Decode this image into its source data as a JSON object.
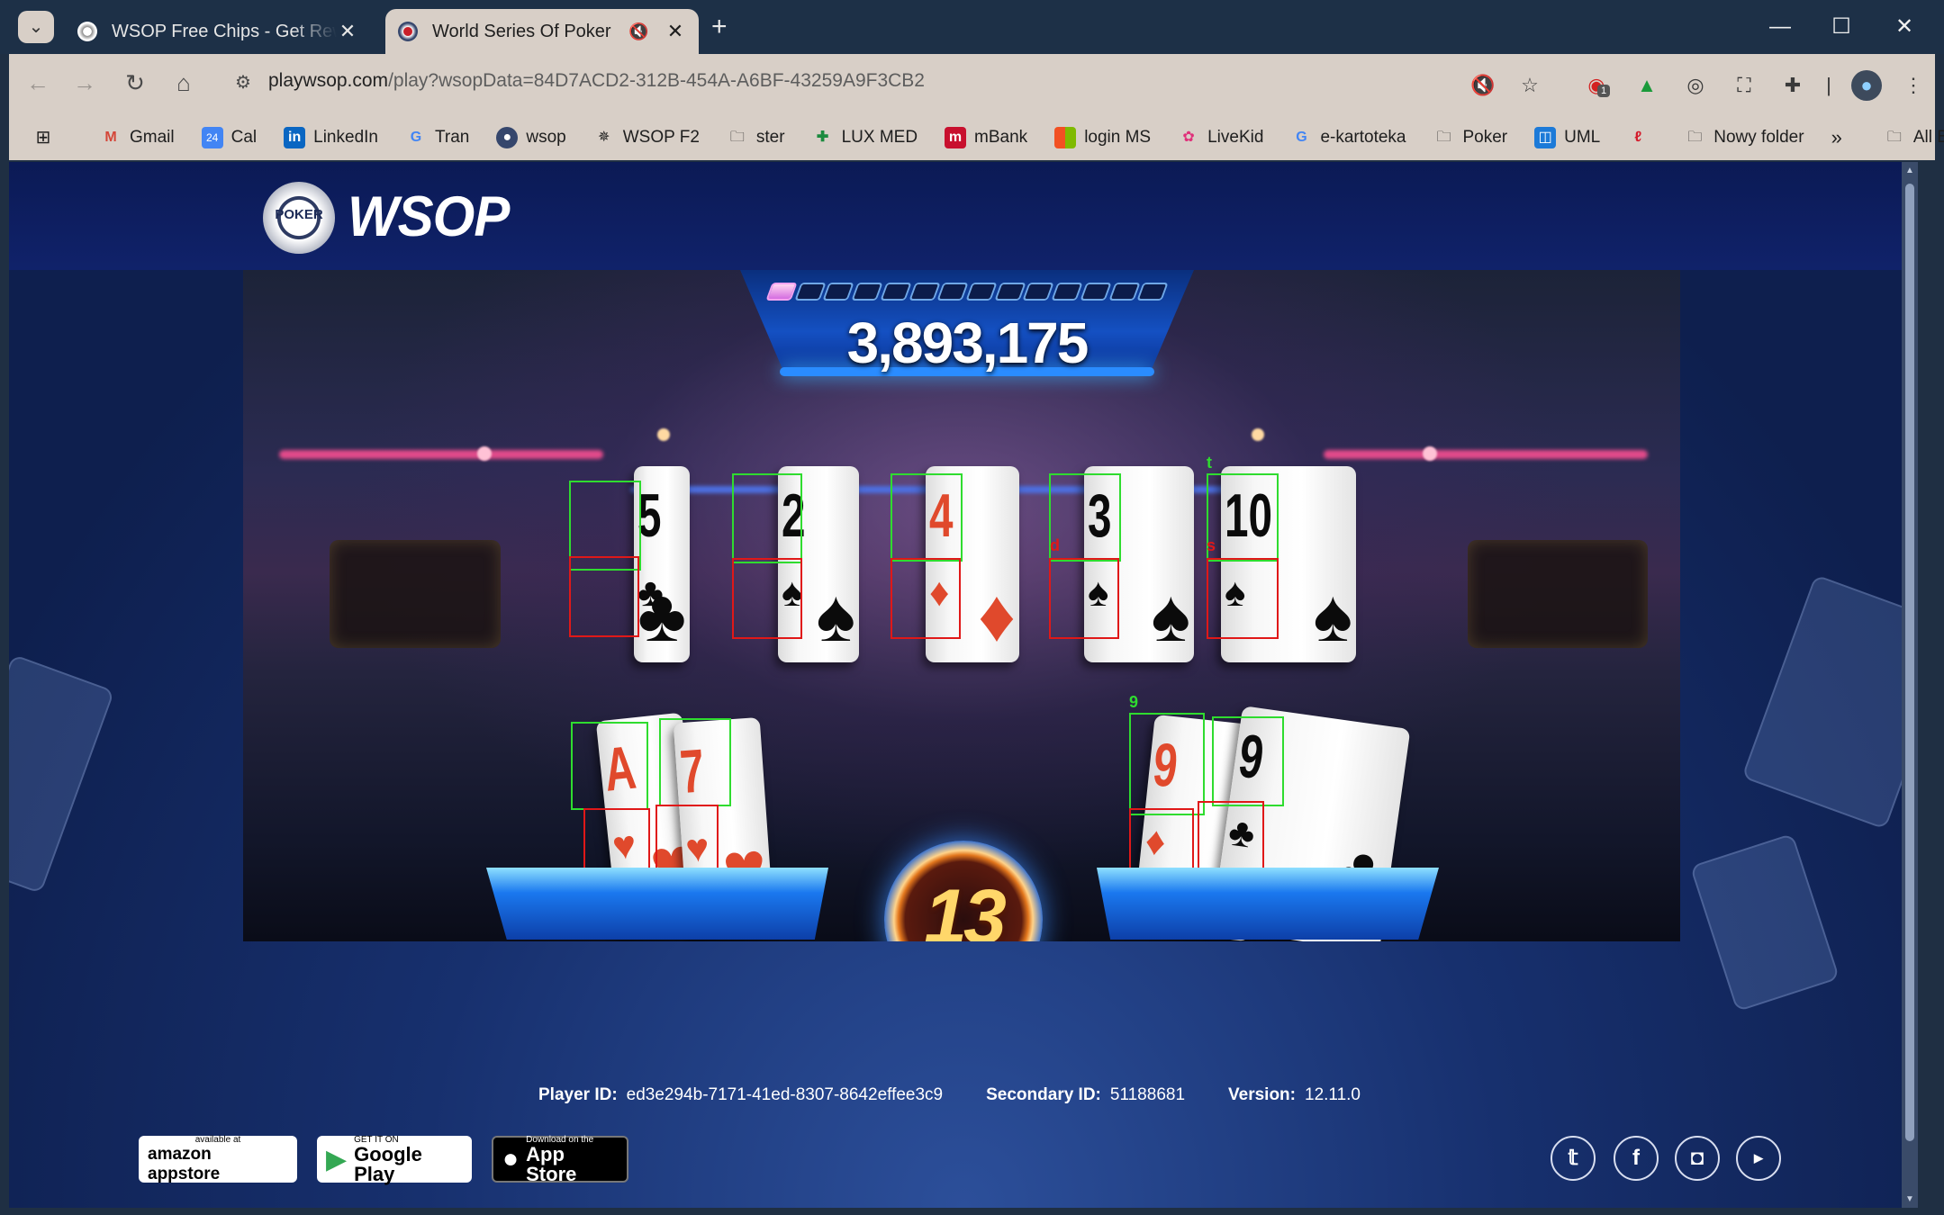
{
  "browser": {
    "tabs": [
      {
        "title": "WSOP Free Chips - Get Rewards",
        "active": false
      },
      {
        "title": "World Series Of Poker",
        "active": true
      }
    ],
    "url_host": "playwsop.com",
    "url_path": "/play?wsopData=84D7ACD2-312B-454A-A6BF-43259A9F3CB2",
    "extension_badge": "1",
    "bookmarks": [
      "Gmail",
      "Cal",
      "LinkedIn",
      "Tran",
      "wsop",
      "WSOP F2",
      "ster",
      "LUX MED",
      "mBank",
      "login MS",
      "LiveKid",
      "e-kartoteka",
      "Poker",
      "UML",
      "",
      "Nowy folder"
    ],
    "all_bookmarks": "All Bookmarks"
  },
  "site": {
    "logo_chip_text": "POKER",
    "logo_text": "WSOP"
  },
  "game": {
    "score": "3,893,175",
    "progress_filled": 1,
    "progress_total": 14,
    "timer": "13",
    "community_cards": [
      {
        "rank": "5",
        "suit": "♣",
        "color": "black"
      },
      {
        "rank": "2",
        "suit": "♠",
        "color": "black"
      },
      {
        "rank": "4",
        "suit": "♦",
        "color": "red"
      },
      {
        "rank": "3",
        "suit": "♠",
        "color": "black"
      },
      {
        "rank": "10",
        "suit": "♠",
        "color": "black"
      }
    ],
    "left_hand": [
      {
        "rank": "A",
        "suit": "♥",
        "color": "red"
      },
      {
        "rank": "7",
        "suit": "♥",
        "color": "red"
      }
    ],
    "right_hand": [
      {
        "rank": "9",
        "suit": "♦",
        "color": "red"
      },
      {
        "rank": "9",
        "suit": "♣",
        "color": "black"
      }
    ],
    "overlay_labels": {
      "t": "t",
      "d": "d",
      "s": "s",
      "nine": "9"
    }
  },
  "footer": {
    "player_id_label": "Player ID:",
    "player_id": "ed3e294b-7171-41ed-8307-8642effee3c9",
    "secondary_id_label": "Secondary ID:",
    "secondary_id": "51188681",
    "version_label": "Version:",
    "version": "12.11.0",
    "stores": {
      "amazon_small": "available at",
      "amazon_big": "amazon appstore",
      "google_small": "GET IT ON",
      "google_big": "Google Play",
      "apple_small": "Download on the",
      "apple_big": "App Store"
    },
    "social_icons": [
      "twitter-icon",
      "facebook-icon",
      "instagram-icon",
      "youtube-icon"
    ]
  },
  "colors": {
    "page_bg": "#17306e",
    "header_bg": "#0b1a55",
    "score_panel": "#1450c2",
    "box_green": "#2fdc2f",
    "box_red": "#e01818"
  }
}
